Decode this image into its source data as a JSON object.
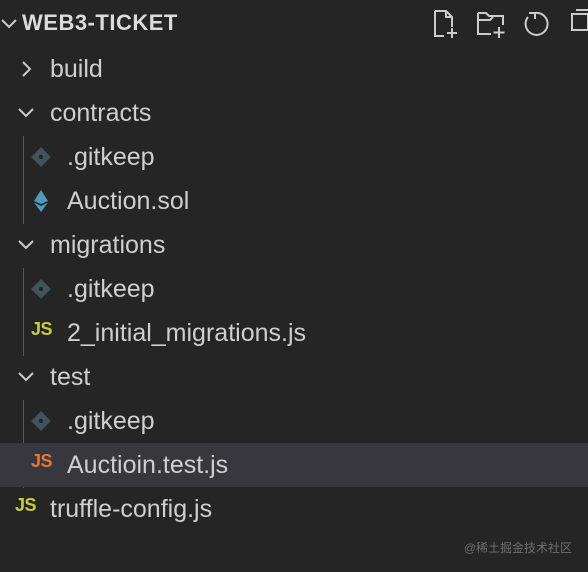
{
  "explorer": {
    "folder_title": "WEB3-TICKET",
    "actions": [
      "new-file-icon",
      "new-folder-icon",
      "refresh-icon",
      "collapse-all-icon"
    ],
    "items": [
      {
        "label": "build",
        "type": "folder",
        "expanded": false
      },
      {
        "label": "contracts",
        "type": "folder",
        "expanded": true
      },
      {
        "label": ".gitkeep",
        "type": "file",
        "icon": "git-icon"
      },
      {
        "label": "Auction.sol",
        "type": "file",
        "icon": "ethereum-icon"
      },
      {
        "label": "migrations",
        "type": "folder",
        "expanded": true
      },
      {
        "label": ".gitkeep",
        "type": "file",
        "icon": "git-icon"
      },
      {
        "label": "2_initial_migrations.js",
        "type": "file",
        "icon": "js-icon",
        "badge": "JS"
      },
      {
        "label": "test",
        "type": "folder",
        "expanded": true
      },
      {
        "label": ".gitkeep",
        "type": "file",
        "icon": "git-icon"
      },
      {
        "label": "Auctioin.test.js",
        "type": "file",
        "icon": "js-icon",
        "badge": "JS",
        "selected": true
      },
      {
        "label": "truffle-config.js",
        "type": "file",
        "icon": "js-icon",
        "badge": "JS"
      }
    ]
  },
  "colors": {
    "background": "#252526",
    "selection": "#37373d",
    "js_yellow": "#cbcb41",
    "js_orange": "#e37933",
    "ethereum_blue": "#519aba"
  },
  "watermark": "@稀土掘金技术社区"
}
